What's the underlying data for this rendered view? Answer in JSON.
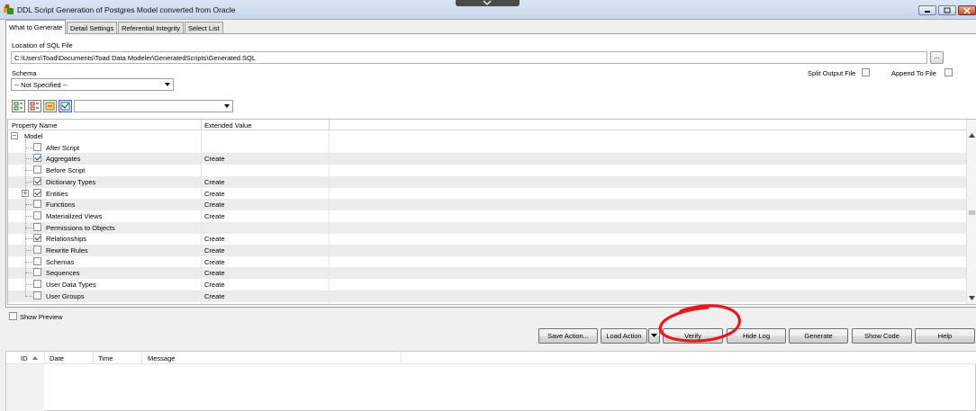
{
  "window": {
    "title": "DDL Script Generation of Postgres Model converted from Oracle"
  },
  "tabs": [
    {
      "label": "What to Generate",
      "active": true
    },
    {
      "label": "Detail Settings",
      "active": false
    },
    {
      "label": "Referential Integrity",
      "active": false
    },
    {
      "label": "Select List",
      "active": false
    }
  ],
  "location": {
    "label": "Location of SQL File",
    "value": "C:\\Users\\Toad\\Documents\\Toad Data Modeler\\GeneratedScripts\\Generated.SQL",
    "browse_label": "..."
  },
  "schema": {
    "label": "Schema",
    "selected": "-- Not Specified --"
  },
  "options": {
    "split_output_label": "Split Output File",
    "append_label": "Append To File"
  },
  "grid": {
    "columns": [
      "Property Name",
      "Extended Value"
    ],
    "root": {
      "label": "Model",
      "expand": "−"
    },
    "rows": [
      {
        "name": "After Script",
        "checked": false,
        "value": ""
      },
      {
        "name": "Aggregates",
        "checked": true,
        "value": "Create"
      },
      {
        "name": "Before Script",
        "checked": false,
        "value": ""
      },
      {
        "name": "Dictionary Types",
        "checked": true,
        "value": "Create"
      },
      {
        "name": "Entities",
        "checked": true,
        "value": "Create",
        "expand": "+"
      },
      {
        "name": "Functions",
        "checked": false,
        "value": "Create"
      },
      {
        "name": "Materialized Views",
        "checked": false,
        "value": "Create"
      },
      {
        "name": "Permissions to Objects",
        "checked": false,
        "value": ""
      },
      {
        "name": "Relationships",
        "checked": true,
        "value": "Create"
      },
      {
        "name": "Rewrite Rules",
        "checked": false,
        "value": "Create"
      },
      {
        "name": "Schemas",
        "checked": false,
        "value": "Create"
      },
      {
        "name": "Sequences",
        "checked": false,
        "value": "Create"
      },
      {
        "name": "User Data Types",
        "checked": false,
        "value": "Create"
      },
      {
        "name": "User Groups",
        "checked": false,
        "value": "Create"
      }
    ]
  },
  "show_preview": {
    "label": "Show Preview",
    "checked": false
  },
  "buttons": {
    "save_action": "Save Action...",
    "load_action": "Load Action",
    "verify": "Verify",
    "hide_log": "Hide Log",
    "generate": "Generate",
    "show_code": "Show Code",
    "help": "Help"
  },
  "log": {
    "columns": [
      "ID",
      "Date",
      "Time",
      "Message"
    ]
  },
  "colors": {
    "annotation_circle": "#e8191e"
  }
}
